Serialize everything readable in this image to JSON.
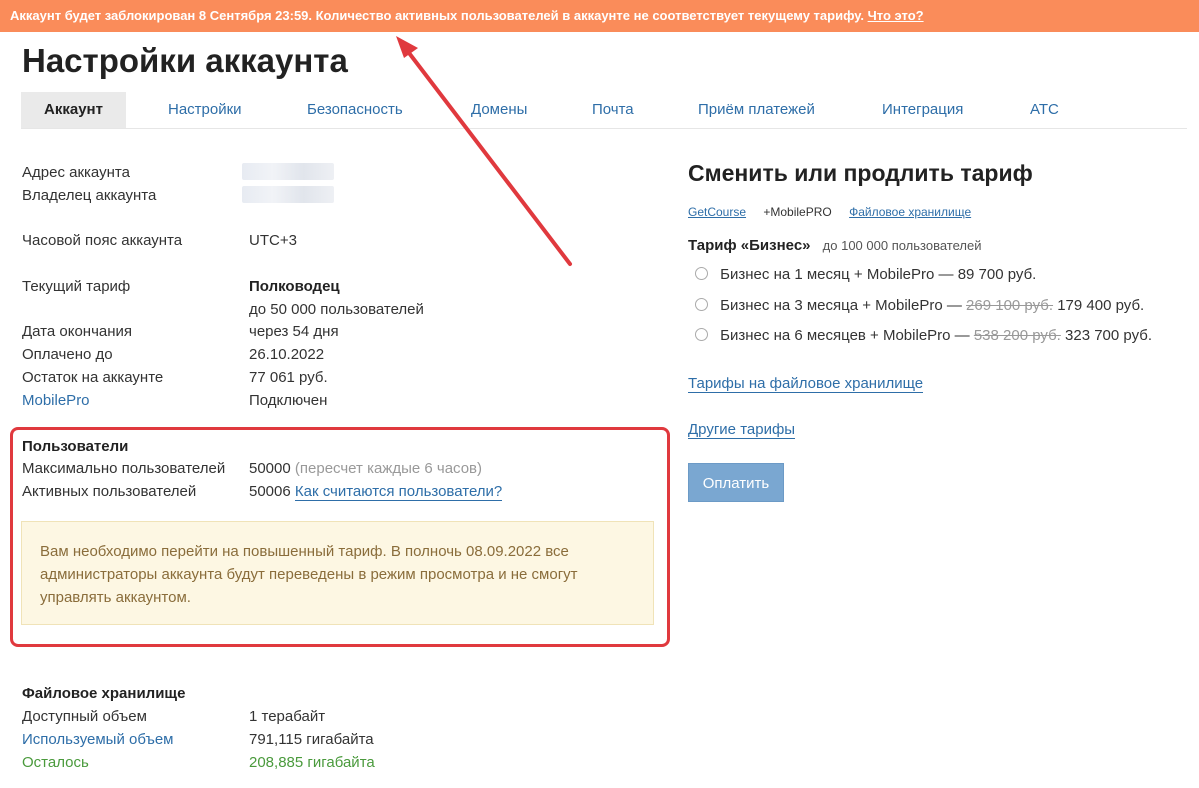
{
  "banner": {
    "text": "Аккаунт будет заблокирован 8 Сентября 23:59. Количество активных пользователей в аккаунте не соответствует текущему тарифу.",
    "link": "Что это?"
  },
  "page_title": "Настройки аккаунта",
  "tabs": [
    {
      "label": "Аккаунт",
      "active": true
    },
    {
      "label": "Настройки"
    },
    {
      "label": "Безопасность"
    },
    {
      "label": "Домены"
    },
    {
      "label": "Почта"
    },
    {
      "label": "Приём платежей"
    },
    {
      "label": "Интеграция"
    },
    {
      "label": "АТС"
    }
  ],
  "account": {
    "address_label": "Адрес аккаунта",
    "owner_label": "Владелец аккаунта",
    "timezone_label": "Часовой пояс аккаунта",
    "timezone_value": "UTC+3",
    "tariff_label": "Текущий тариф",
    "tariff_value": "Полководец",
    "tariff_users": "до 50 000 пользователей",
    "end_label": "Дата окончания",
    "end_value": "через 54 дня",
    "paid_label": "Оплачено до",
    "paid_value": "26.10.2022",
    "balance_label": "Остаток на аккаунте",
    "balance_value": "77 061 руб.",
    "mobilepro_label": "MobilePro",
    "mobilepro_value": "Подключен"
  },
  "users": {
    "heading": "Пользователи",
    "max_label": "Максимально пользователей",
    "max_value": "50000",
    "max_note": "(пересчет каждые 6 часов)",
    "active_label": "Активных пользователей",
    "active_value": "50006",
    "active_link": "Как считаются пользователи?",
    "warning": "Вам необходимо перейти на повышенный тариф. В полночь 08.09.2022 все администраторы аккаунта будут переведены в режим просмотра и не смогут управлять аккаунтом."
  },
  "storage": {
    "heading": "Файловое хранилище",
    "available_label": "Доступный объем",
    "available_value": "1 терабайт",
    "used_label": "Используемый объем",
    "used_value": "791,115 гигабайта",
    "left_label": "Осталось",
    "left_value": "208,885 гигабайта"
  },
  "tariff_panel": {
    "title": "Сменить или продлить тариф",
    "sublinks": [
      "GetCourse",
      "+MobilePRO",
      "Файловое хранилище"
    ],
    "plan_name": "Тариф «Бизнес»",
    "plan_users": "до 100 000 пользователей",
    "options": [
      {
        "label": "Бизнес на 1 месяц + MobilePro —",
        "old": "",
        "price": "89 700 руб."
      },
      {
        "label": "Бизнес на 3 месяца + MobilePro —",
        "old": "269 100 руб.",
        "price": "179 400 руб."
      },
      {
        "label": "Бизнес на 6 месяцев + MobilePro —",
        "old": "538 200 руб.",
        "price": "323 700 руб."
      }
    ],
    "storage_link": "Тарифы на файловое хранилище",
    "other_link": "Другие тарифы",
    "pay_button": "Оплатить"
  },
  "colors": {
    "banner": "#fa8c5a",
    "link": "#2e6ea8",
    "annotation": "#e0393e",
    "warning_bg": "#fdf7e3",
    "button": "#7aa7d1"
  }
}
